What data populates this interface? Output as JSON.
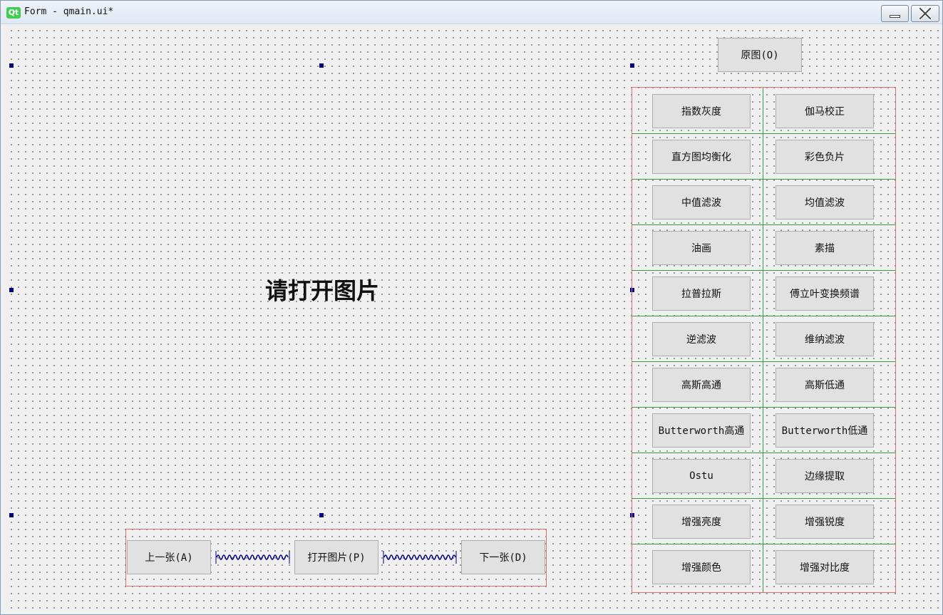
{
  "window": {
    "title": "Form - qmain.ui*",
    "logo_text": "Qt",
    "minimize_icon": "minimize-icon",
    "close_icon": "close-icon"
  },
  "image_label": "请打开图片",
  "original_button": "原图(O)",
  "bottom_buttons": {
    "prev": "上一张(A)",
    "open": "打开图片(P)",
    "next": "下一张(D)"
  },
  "grid_buttons": [
    [
      "指数灰度",
      "伽马校正"
    ],
    [
      "直方图均衡化",
      "彩色负片"
    ],
    [
      "中值滤波",
      "均值滤波"
    ],
    [
      "油画",
      "素描"
    ],
    [
      "拉普拉斯",
      "傅立叶变换频谱"
    ],
    [
      "逆滤波",
      "维纳滤波"
    ],
    [
      "高斯高通",
      "高斯低通"
    ],
    [
      "Butterworth高通",
      "Butterworth低通"
    ],
    [
      "Ostu",
      "边缘提取"
    ],
    [
      "增强亮度",
      "增强锐度"
    ],
    [
      "增强颜色",
      "增强对比度"
    ]
  ],
  "colors": {
    "layout_border": "#e26d6d",
    "grid_line": "#2ea043",
    "selection_handle": "#000080",
    "button_face": "#e1e1e1",
    "qt_green": "#41cd52"
  }
}
